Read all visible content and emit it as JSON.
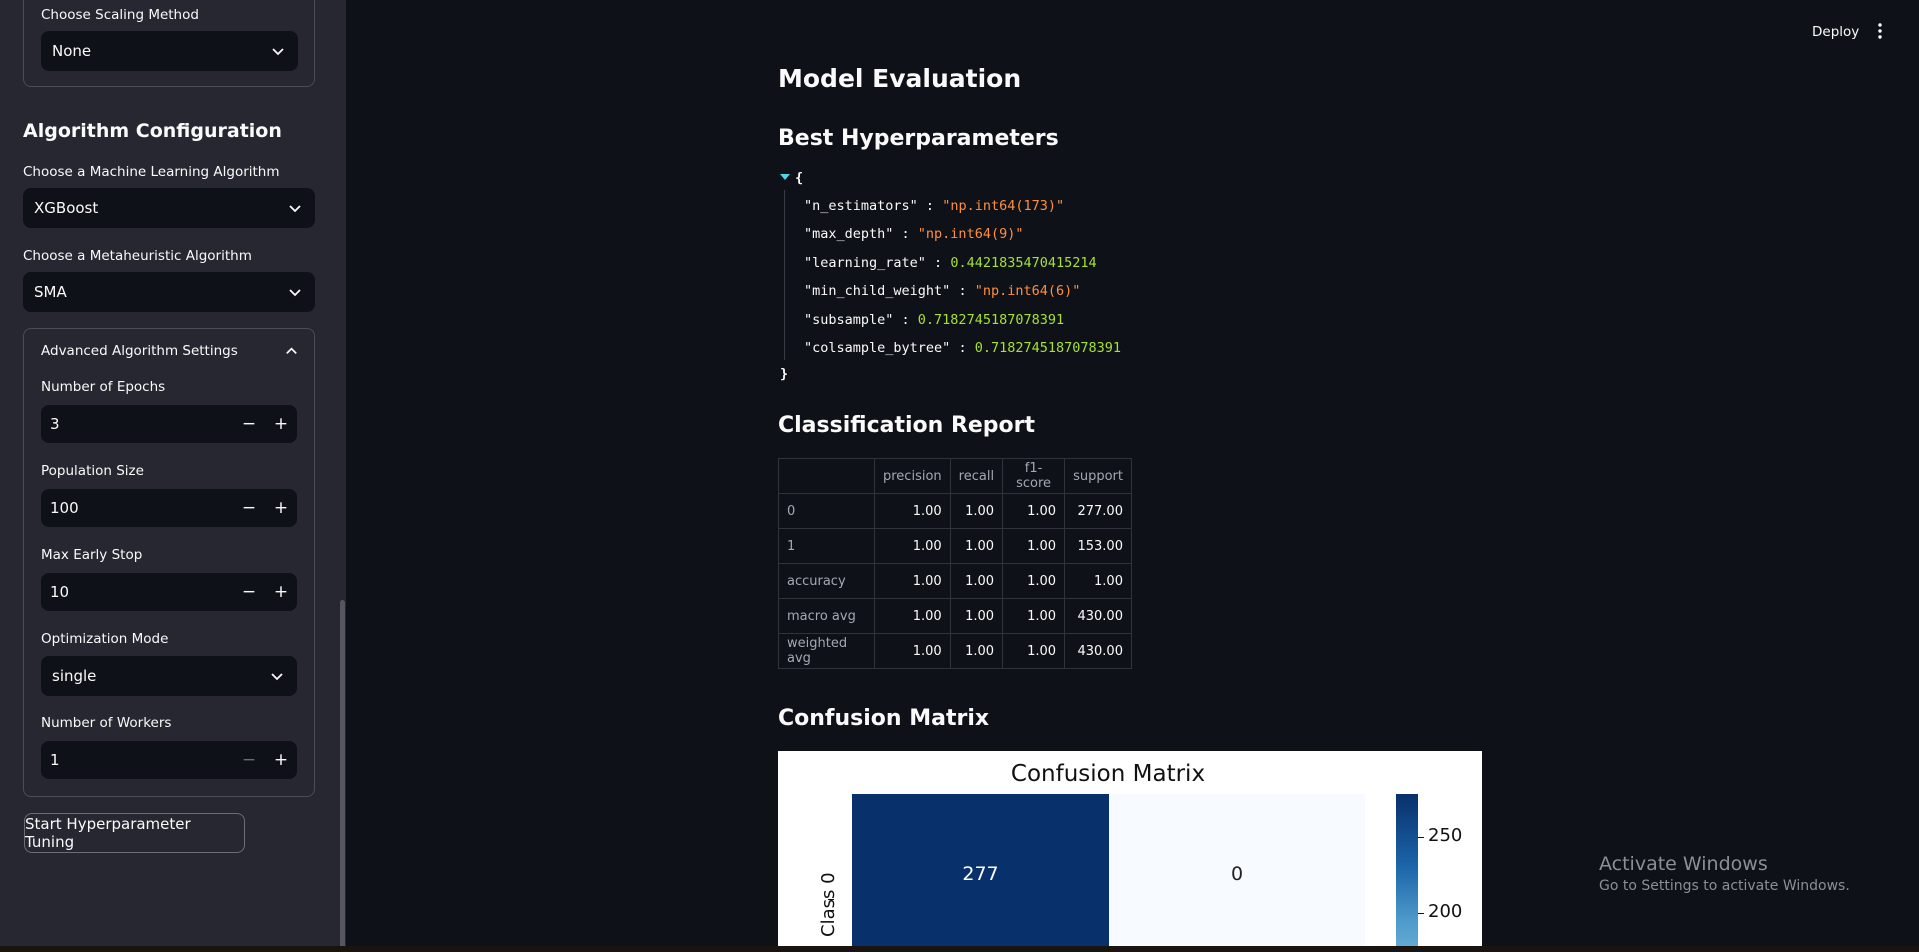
{
  "sidebar": {
    "scaling": {
      "label": "Choose Scaling Method",
      "value": "None"
    },
    "algo_header": "Algorithm Configuration",
    "ml_algo": {
      "label": "Choose a Machine Learning Algorithm",
      "value": "XGBoost"
    },
    "meta_algo": {
      "label": "Choose a Metaheuristic Algorithm",
      "value": "SMA"
    },
    "advanced": {
      "title": "Advanced Algorithm Settings",
      "epochs": {
        "label": "Number of Epochs",
        "value": "3"
      },
      "population": {
        "label": "Population Size",
        "value": "100"
      },
      "early_stop": {
        "label": "Max Early Stop",
        "value": "10"
      },
      "mode": {
        "label": "Optimization Mode",
        "value": "single"
      },
      "workers": {
        "label": "Number of Workers",
        "value": "1"
      }
    },
    "start_button": "Start Hyperparameter Tuning"
  },
  "header": {
    "deploy": "Deploy"
  },
  "main": {
    "title": "Model Evaluation",
    "hyper_title": "Best Hyperparameters",
    "json": {
      "open": "{",
      "close": "}",
      "rows": [
        {
          "key": "\"n_estimators\"",
          "value": "\"np.int64(173)\""
        },
        {
          "key": "\"max_depth\"",
          "value": "\"np.int64(9)\""
        },
        {
          "key": "\"learning_rate\"",
          "value": "0.4421835470415214"
        },
        {
          "key": "\"min_child_weight\"",
          "value": "\"np.int64(6)\""
        },
        {
          "key": "\"subsample\"",
          "value": "0.7182745187078391"
        },
        {
          "key": "\"colsample_bytree\"",
          "value": "0.7182745187078391"
        }
      ]
    },
    "report_title": "Classification Report",
    "report": {
      "columns": [
        "",
        "precision",
        "recall",
        "f1-score",
        "support"
      ],
      "rows": [
        [
          "0",
          "1.00",
          "1.00",
          "1.00",
          "277.00"
        ],
        [
          "1",
          "1.00",
          "1.00",
          "1.00",
          "153.00"
        ],
        [
          "accuracy",
          "1.00",
          "1.00",
          "1.00",
          "1.00"
        ],
        [
          "macro avg",
          "1.00",
          "1.00",
          "1.00",
          "430.00"
        ],
        [
          "weighted avg",
          "1.00",
          "1.00",
          "1.00",
          "430.00"
        ]
      ]
    },
    "cm_title": "Confusion Matrix"
  },
  "chart_data": {
    "type": "heatmap",
    "title": "Confusion Matrix",
    "y_tick_labels": [
      "Class 0"
    ],
    "cells": [
      [
        277,
        0
      ]
    ],
    "colorbar_ticks": [
      "250",
      "200"
    ],
    "colormap": "Blues"
  },
  "watermark": {
    "line1": "Activate Windows",
    "line2": "Go to Settings to activate Windows."
  },
  "colors": {
    "background": "#0e1117",
    "sidebar": "#262730",
    "string": "#ff8f3e",
    "number": "#a6e22e",
    "cm_dark": "#08306b",
    "cm_light": "#f7fbff"
  }
}
